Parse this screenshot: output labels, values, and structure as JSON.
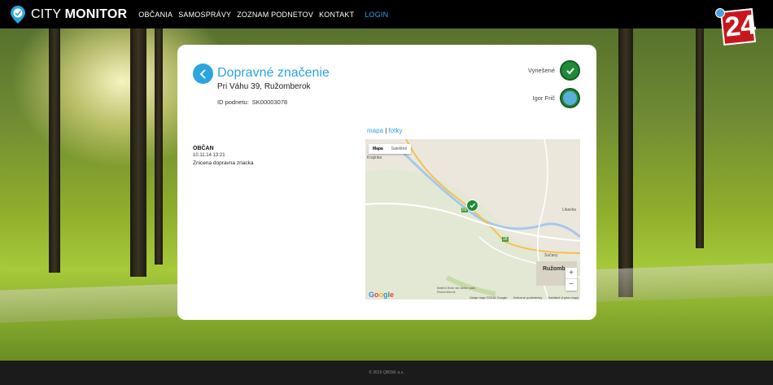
{
  "brand": {
    "name_light": "CITY ",
    "name_bold": "MONITOR"
  },
  "nav": {
    "items": [
      "OBČANIA",
      "SAMOSPRÁVY",
      "ZOZNAM PODNETOV",
      "KONTAKT"
    ],
    "login": "LOGIN"
  },
  "badge": {
    "text": "24"
  },
  "issue": {
    "title": "Dopravné značenie",
    "address": "Pri Váhu 39, Ružomberok",
    "id_label": "ID podnetu:",
    "id_value": "SK00003078",
    "status_label": "Vyriešené",
    "assignee": "Igor Frič"
  },
  "citizen": {
    "heading": "OBČAN",
    "datetime": "10.11.14 13:21",
    "text": "Znicena dopravna znacka"
  },
  "map": {
    "link_map": "mapa",
    "link_sep": " | ",
    "link_photos": "fotky",
    "tabs": [
      "Mapa",
      "Satelitné"
    ],
    "zoom_in": "+",
    "zoom_out": "−",
    "labels": {
      "l1": "Krajinka",
      "l2": "Likavka",
      "l3": "Ružomb",
      "l4": "Malinô Brdo ski &bike park Ružomberok",
      "l5": "Sučany",
      "l6": "59",
      "l7": "18"
    },
    "footer": [
      "Údaje máp ©2016 Google",
      "Zmluvné podmienky",
      "Nahlásiť chybu mapy"
    ]
  },
  "footer": {
    "copyright": "© 2015 QBSW, a.s."
  },
  "colors": {
    "accent": "#2aa5e0",
    "status_green": "#1f8a3a",
    "topbar": "#000000",
    "footer": "#1b1b1b"
  }
}
